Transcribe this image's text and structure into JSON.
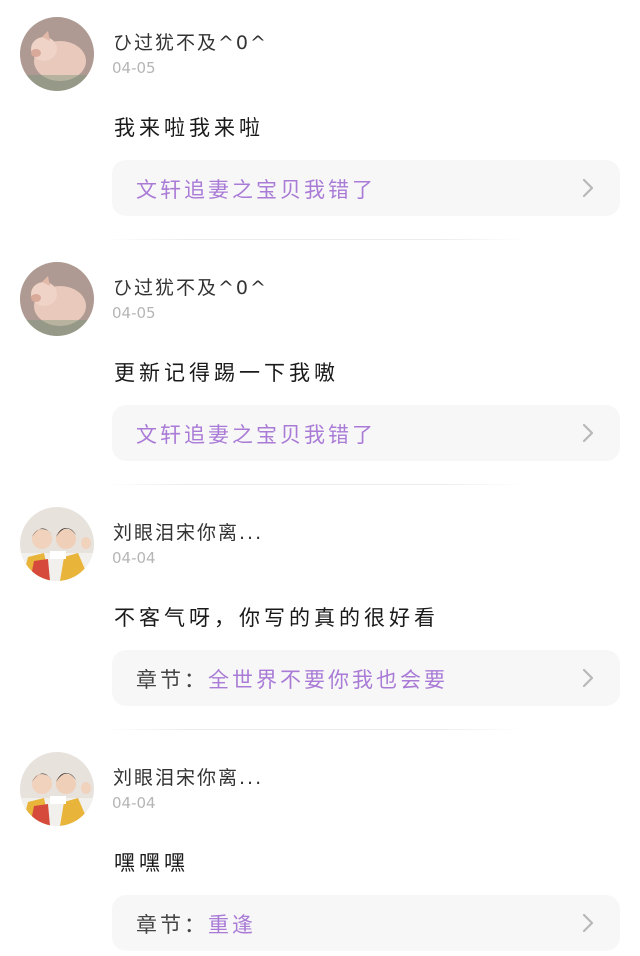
{
  "comments": [
    {
      "avatar": "piglet-avatar",
      "username": "ひ过犹不及^0^",
      "date": "04-05",
      "message": "我来啦我来啦",
      "source_prefix": "",
      "source_title": "文轩追妻之宝贝我错了"
    },
    {
      "avatar": "piglet-avatar",
      "username": "ひ过犹不及^0^",
      "date": "04-05",
      "message": "更新记得踢一下我嗷",
      "source_prefix": "",
      "source_title": "文轩追妻之宝贝我错了"
    },
    {
      "avatar": "two-boys-avatar",
      "username": "刘眼泪宋你离...",
      "date": "04-04",
      "message": "不客气呀，你写的真的很好看",
      "source_prefix": "章节：",
      "source_title": "全世界不要你我也会要"
    },
    {
      "avatar": "two-boys-avatar",
      "username": "刘眼泪宋你离...",
      "date": "04-04",
      "message": "嘿嘿嘿",
      "source_prefix": "章节：",
      "source_title": "重逢"
    }
  ],
  "colors": {
    "accent": "#a97bd6",
    "card_background": "#f7f7f7",
    "date": "#b5b5b5"
  }
}
